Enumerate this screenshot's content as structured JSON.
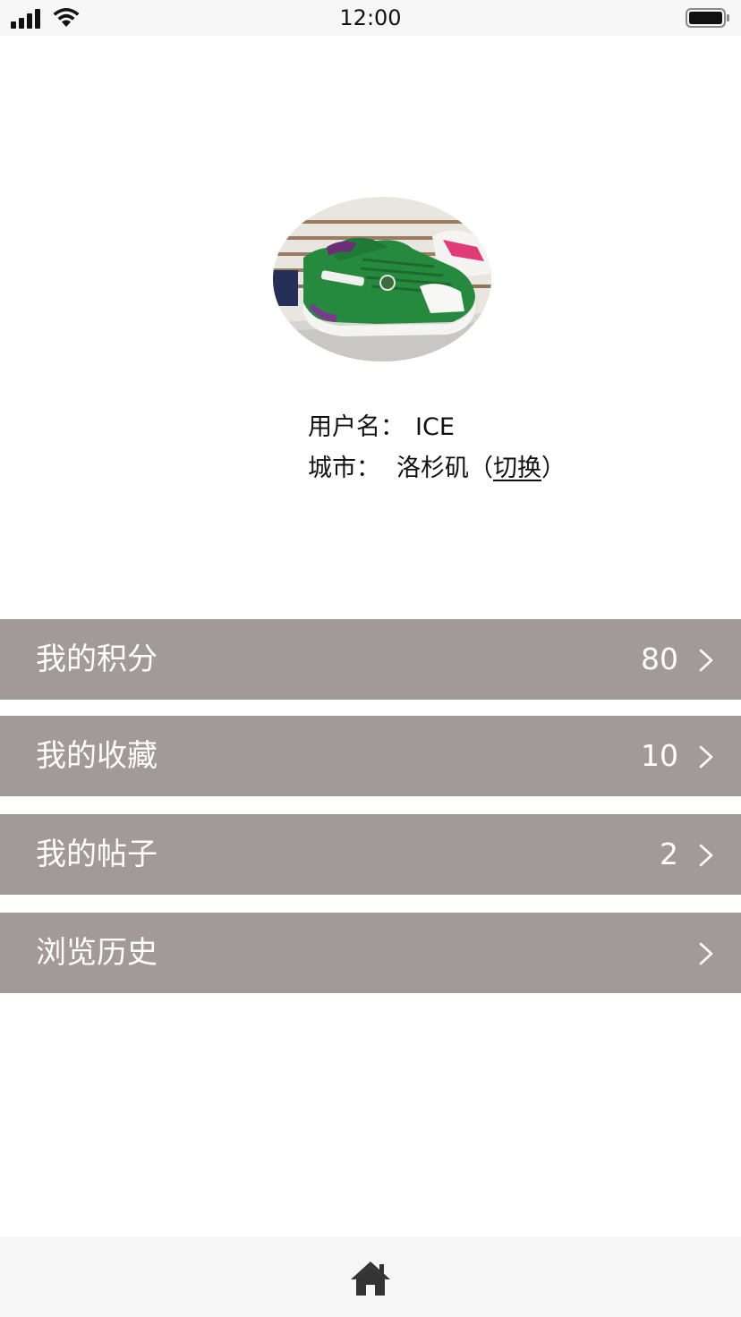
{
  "status_bar": {
    "time": "12:00",
    "icons": [
      "signal-icon",
      "wifi-icon",
      "battery-icon"
    ]
  },
  "profile": {
    "avatar": "avatar",
    "username_label": "用户名：",
    "username": "ICE",
    "city_label": "城市：",
    "city_name": "洛杉矶",
    "city_paren_open": "（",
    "switch_label": "切换",
    "city_paren_close": "）"
  },
  "menu": {
    "items": [
      {
        "label": "我的积分",
        "count": "80"
      },
      {
        "label": "我的收藏",
        "count": "10"
      },
      {
        "label": "我的帖子",
        "count": "2"
      },
      {
        "label": "浏览历史",
        "count": ""
      }
    ],
    "chevron_icon": "chevron-right-icon"
  },
  "tab_bar": {
    "home_icon": "home-icon"
  },
  "colors": {
    "row_background": "#a29a99",
    "row_text": "#ffffff",
    "status_bar_background": "#f7f7f7",
    "tab_bar_background": "#f6f6f6",
    "icon_dark": "#333333"
  }
}
